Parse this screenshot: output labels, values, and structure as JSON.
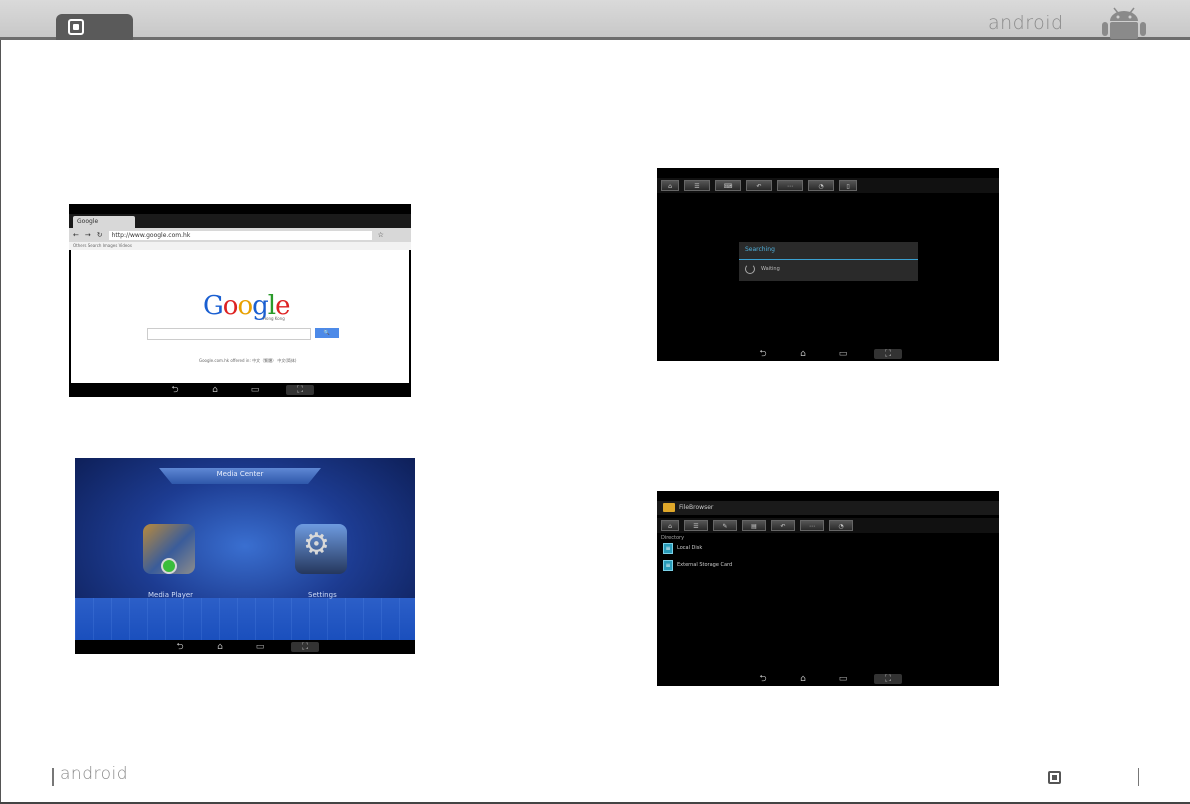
{
  "header": {
    "brand": "android"
  },
  "footer": {
    "brand": "android"
  },
  "browser_screenshot": {
    "tab_label": "Google",
    "url": "http://www.google.com.hk",
    "links_row": "Others  Search  Images  Videos",
    "logo_letters": [
      "G",
      "o",
      "o",
      "g",
      "l",
      "e"
    ],
    "logo_sub": "Hong Kong",
    "search_button": "🔍",
    "offer_text": "Google.com.hk offered in: 中文（繁體） 中文(简体)"
  },
  "media_center_screenshot": {
    "title": "Media Center",
    "player_label": "Media Player",
    "settings_label": "Settings"
  },
  "searching_screenshot": {
    "dialog_title": "Searching",
    "dialog_message": "Waiting"
  },
  "file_explorer_screenshot": {
    "title": "FileBrowser",
    "path": "Directory",
    "items": [
      "Local Disk",
      "External Storage Card"
    ]
  },
  "nav_icons": [
    "back",
    "home",
    "recent",
    "screenshot"
  ],
  "colors": {
    "header_gray": "#d0d0d0",
    "accent_blue": "#3aa0d0",
    "brand_gray": "#8a8a8a"
  }
}
